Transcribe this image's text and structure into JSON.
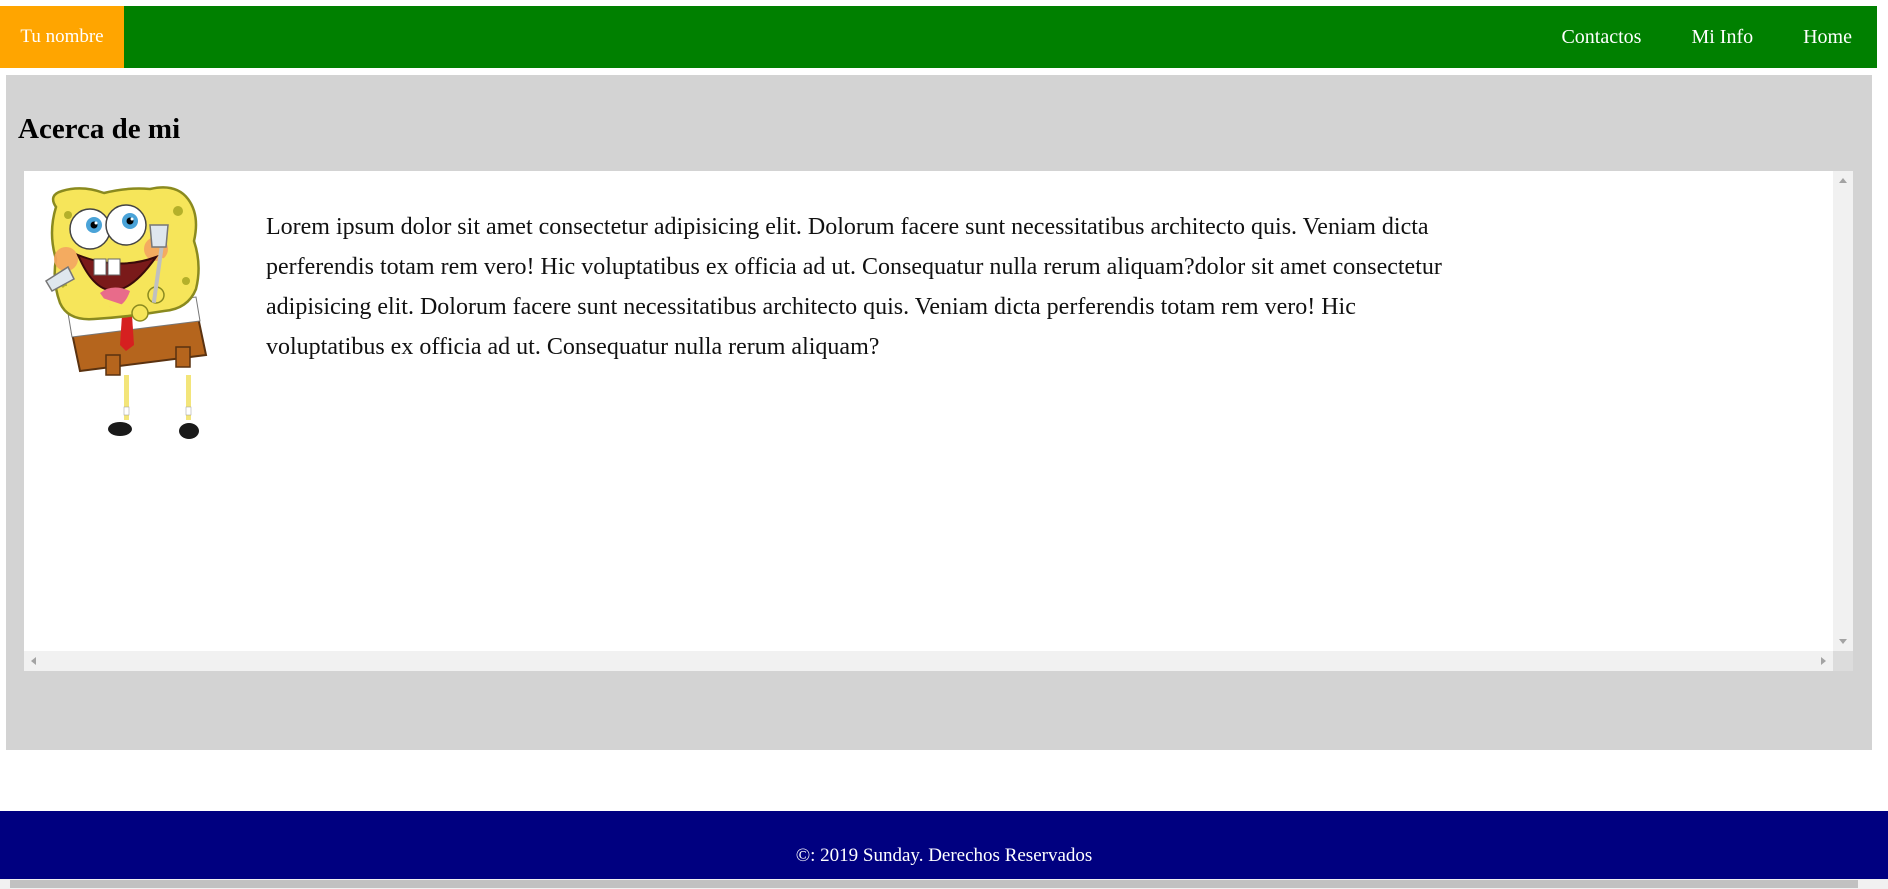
{
  "navbar": {
    "brand": "Tu nombre",
    "links": [
      "Contactos",
      "Mi Info",
      "Home"
    ],
    "colors": {
      "bar": "#008000",
      "brand": "#ffa500"
    }
  },
  "main": {
    "heading": "Acerca de mi",
    "image": {
      "icon": "spongebob-character-image"
    },
    "paragraph": "Lorem ipsum dolor sit amet consectetur adipisicing elit. Dolorum facere sunt necessitatibus architecto quis. Veniam dicta perferendis totam rem vero! Hic voluptatibus ex officia ad ut. Consequatur nulla rerum aliquam?dolor sit amet consectetur adipisicing elit. Dolorum facere sunt necessitatibus architecto quis. Veniam dicta perferendis totam rem vero! Hic voluptatibus ex officia ad ut. Consequatur nulla rerum aliquam?",
    "colors": {
      "section": "#d3d3d3",
      "box": "#ffffff"
    }
  },
  "footer": {
    "text": "©: 2019 Sunday. Derechos Reservados",
    "colors": {
      "background": "#000080"
    }
  }
}
